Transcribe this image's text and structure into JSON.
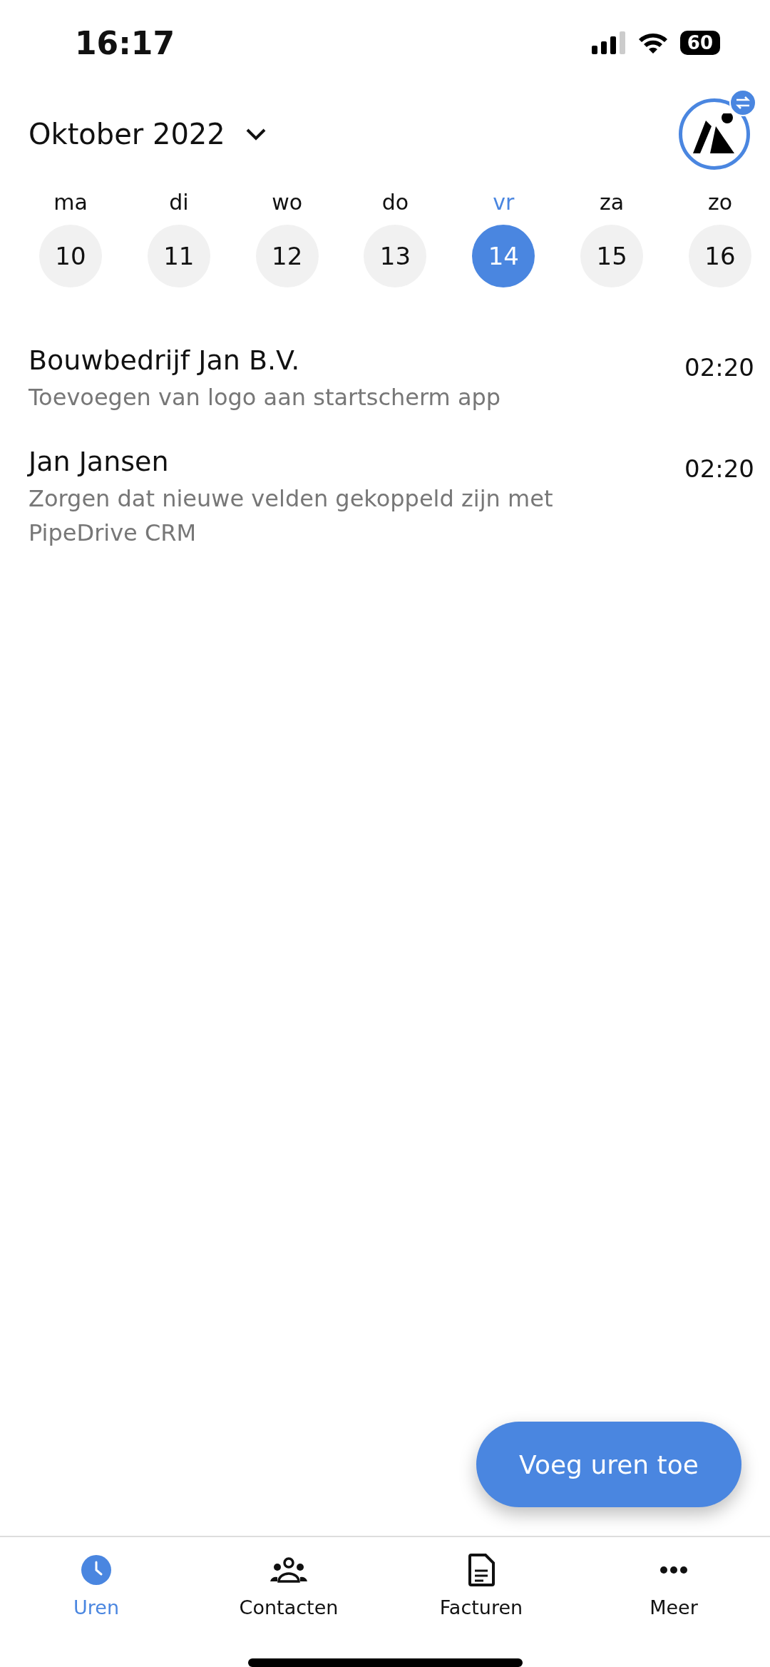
{
  "status_bar": {
    "time": "16:17",
    "battery": "60"
  },
  "header": {
    "month": "Oktober 2022"
  },
  "week": [
    {
      "day": "ma",
      "date": "10",
      "selected": false
    },
    {
      "day": "di",
      "date": "11",
      "selected": false
    },
    {
      "day": "wo",
      "date": "12",
      "selected": false
    },
    {
      "day": "do",
      "date": "13",
      "selected": false
    },
    {
      "day": "vr",
      "date": "14",
      "selected": true
    },
    {
      "day": "za",
      "date": "15",
      "selected": false
    },
    {
      "day": "zo",
      "date": "16",
      "selected": false
    }
  ],
  "entries": [
    {
      "client": "Bouwbedrijf Jan B.V.",
      "description": "Toevoegen van logo aan startscherm app",
      "duration": "02:20"
    },
    {
      "client": "Jan Jansen",
      "description": "Zorgen dat nieuwe velden gekoppeld zijn met PipeDrive CRM",
      "duration": "02:20"
    }
  ],
  "fab": {
    "label": "Voeg uren toe"
  },
  "tab_bar": [
    {
      "kind": "clock",
      "label": "Uren",
      "selected": true
    },
    {
      "kind": "people",
      "label": "Contacten",
      "selected": false
    },
    {
      "kind": "document",
      "label": "Facturen",
      "selected": false
    },
    {
      "kind": "more",
      "label": "Meer",
      "selected": false
    }
  ]
}
